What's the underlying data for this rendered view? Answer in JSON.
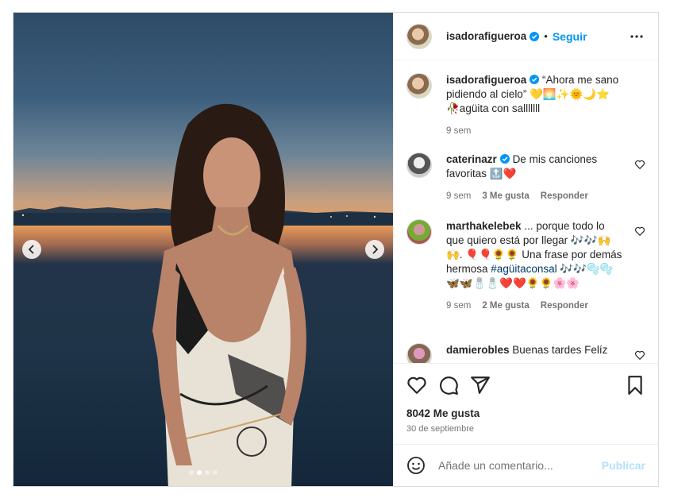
{
  "post": {
    "author": "isadorafigueroa",
    "follow_label": "Seguir",
    "separator": "•",
    "caption_text": "“Ahora me sano pidiendo al cielo” 💛🌅✨🌞🌙⭐ 🥀agüita con salllllll",
    "caption_time": "9 sem",
    "likes": "8042 Me gusta",
    "date": "30 de septiembre",
    "carousel_active": 1,
    "carousel_count": 4
  },
  "comments": [
    {
      "user": "caterinazr",
      "verified": true,
      "text": "De mis canciones favoritas 🔝❤️",
      "time": "9 sem",
      "likes": "3 Me gusta",
      "reply": "Responder"
    },
    {
      "user": "marthakelebek",
      "verified": false,
      "text": "... porque todo lo que quiero está por llegar 🎶🎶🙌🙌. 🎈🎈🌻🌻 Una frase por demás hermosa",
      "hashtag": "#agüitaconsal",
      "emojis": "🎶🎶🫧🫧🦋🦋🧂🧂❤️❤️🌻🌻🌸🌸",
      "time": "9 sem",
      "likes": "2 Me gusta",
      "reply": "Responder"
    },
    {
      "user": "damierobles",
      "verified": false,
      "text": "Buenas tardes Felíz"
    }
  ],
  "composer": {
    "placeholder": "Añade un comentario...",
    "publish_label": "Publicar"
  },
  "colors": {
    "accent": "#0095f6",
    "publish_disabled": "#b2dffc",
    "muted": "#737373",
    "hashtag": "#00376b"
  }
}
